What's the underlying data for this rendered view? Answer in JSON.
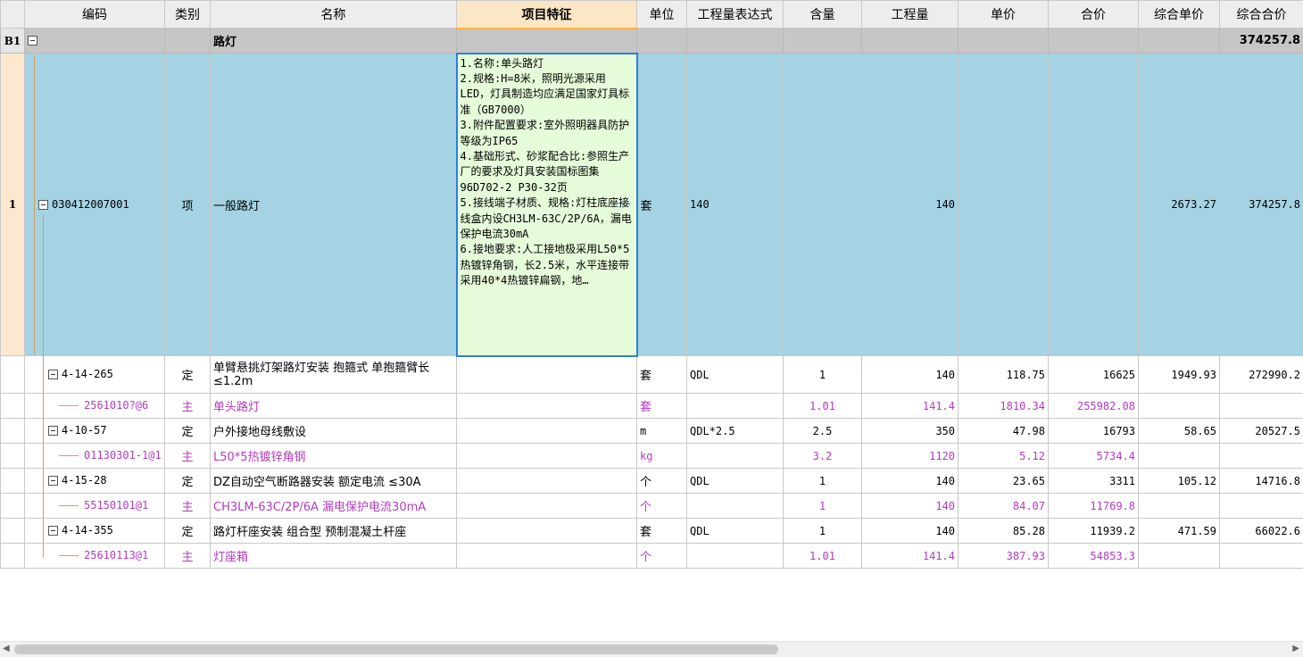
{
  "headers": [
    "编码",
    "类别",
    "名称",
    "项目特征",
    "单位",
    "工程量表达式",
    "含量",
    "工程量",
    "单价",
    "合价",
    "综合单价",
    "综合合价"
  ],
  "group": {
    "rownum": "B1",
    "name": "路灯",
    "total": "374257.8"
  },
  "main": {
    "rownum": "1",
    "code": "030412007001",
    "type": "项",
    "name": "一般路灯",
    "feature": "1.名称:单头路灯\n2.规格:H=8米，照明光源采用LED，灯具制造均应满足国家灯具标准（GB7000）\n3.附件配置要求:室外照明器具防护等级为IP65\n4.基础形式、砂浆配合比:参照生产厂的要求及灯具安装国标图集96D702-2 P30-32页\n5.接线端子材质、规格:灯柱底座接线盒内设CH3LM-63C/2P/6A，漏电保护电流30mA\n6.接地要求:人工接地极采用L50*5热镀锌角钢，长2.5米，水平连接带采用40*4热镀锌扁钢，地…",
    "unit": "套",
    "expr": "140",
    "qty": "140",
    "comp_price": "2673.27",
    "comp_total": "374257.8"
  },
  "rows": [
    {
      "level": "quota",
      "code": "4-14-265",
      "type": "定",
      "name": "单臂悬挑灯架路灯安装 抱箍式 单抱箍臂长≤1.2m",
      "unit": "套",
      "expr": "QDL",
      "content": "1",
      "qty": "140",
      "price": "118.75",
      "total": "16625",
      "comp_price": "1949.93",
      "comp_total": "272990.2"
    },
    {
      "level": "material",
      "code": "2561010?@6",
      "type": "主",
      "name": "单头路灯",
      "unit": "套",
      "expr": "",
      "content": "1.01",
      "qty": "141.4",
      "price": "1810.34",
      "total": "255982.08",
      "comp_price": "",
      "comp_total": ""
    },
    {
      "level": "quota",
      "code": "4-10-57",
      "type": "定",
      "name": "户外接地母线敷设",
      "unit": "m",
      "expr": "QDL*2.5",
      "content": "2.5",
      "qty": "350",
      "price": "47.98",
      "total": "16793",
      "comp_price": "58.65",
      "comp_total": "20527.5"
    },
    {
      "level": "material",
      "code": "01130301-1@1",
      "type": "主",
      "name": "L50*5热镀锌角钢",
      "unit": "kg",
      "expr": "",
      "content": "3.2",
      "qty": "1120",
      "price": "5.12",
      "total": "5734.4",
      "comp_price": "",
      "comp_total": ""
    },
    {
      "level": "quota",
      "code": "4-15-28",
      "type": "定",
      "name": "DZ自动空气断路器安装 额定电流 ≤30A",
      "unit": "个",
      "expr": "QDL",
      "content": "1",
      "qty": "140",
      "price": "23.65",
      "total": "3311",
      "comp_price": "105.12",
      "comp_total": "14716.8"
    },
    {
      "level": "material",
      "code": "55150101@1",
      "type": "主",
      "name": "CH3LM-63C/2P/6A 漏电保护电流30mA",
      "unit": "个",
      "expr": "",
      "content": "1",
      "qty": "140",
      "price": "84.07",
      "total": "11769.8",
      "comp_price": "",
      "comp_total": ""
    },
    {
      "level": "quota",
      "code": "4-14-355",
      "type": "定",
      "name": "路灯杆座安装 组合型 预制混凝土杆座",
      "unit": "套",
      "expr": "QDL",
      "content": "1",
      "qty": "140",
      "price": "85.28",
      "total": "11939.2",
      "comp_price": "471.59",
      "comp_total": "66022.6"
    },
    {
      "level": "material",
      "code": "25610113@1",
      "type": "主",
      "name": "灯座箱",
      "unit": "个",
      "expr": "",
      "content": "1.01",
      "qty": "141.4",
      "price": "387.93",
      "total": "54853.3",
      "comp_price": "",
      "comp_total": ""
    }
  ],
  "colors": {
    "selected_row": "#a5d3e3",
    "feature_cell": "#e6fbd9",
    "material_text": "#b23bbf",
    "group_row": "#c6c6c6"
  }
}
